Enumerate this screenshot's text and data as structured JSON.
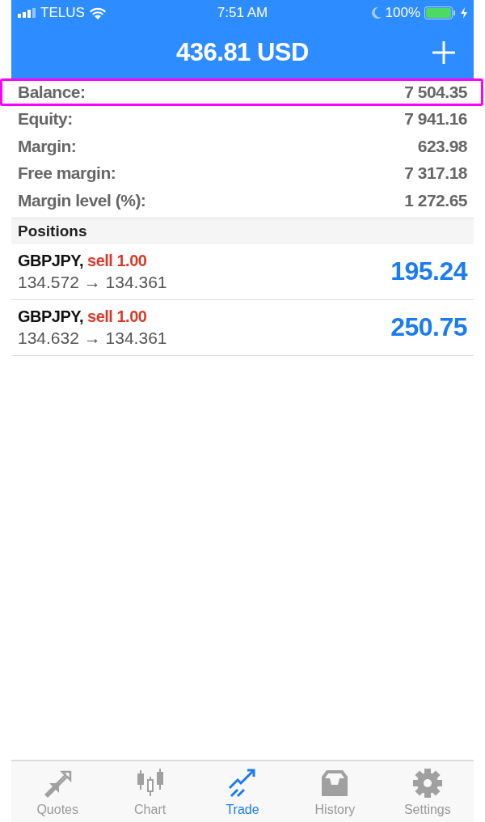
{
  "status_bar": {
    "carrier": "TELUS",
    "time": "7:51 AM",
    "battery": "100%"
  },
  "header": {
    "title": "436.81 USD"
  },
  "account": [
    {
      "label": "Balance:",
      "value": "7 504.35",
      "highlighted": true
    },
    {
      "label": "Equity:",
      "value": "7 941.16",
      "highlighted": false
    },
    {
      "label": "Margin:",
      "value": "623.98",
      "highlighted": false
    },
    {
      "label": "Free margin:",
      "value": "7 317.18",
      "highlighted": false
    },
    {
      "label": "Margin level (%):",
      "value": "1 272.65",
      "highlighted": false
    }
  ],
  "positions": {
    "heading": "Positions",
    "items": [
      {
        "symbol": "GBPJPY,",
        "order": "sell 1.00",
        "prices": "134.572 → 134.361",
        "profit": "195.24"
      },
      {
        "symbol": "GBPJPY,",
        "order": "sell 1.00",
        "prices": "134.632 → 134.361",
        "profit": "250.75"
      }
    ]
  },
  "tabs": [
    {
      "label": "Quotes",
      "kind": "quotes",
      "selected": false
    },
    {
      "label": "Chart",
      "kind": "chart",
      "selected": false
    },
    {
      "label": "Trade",
      "kind": "trade",
      "selected": true
    },
    {
      "label": "History",
      "kind": "history",
      "selected": false
    },
    {
      "label": "Settings",
      "kind": "settings",
      "selected": false
    }
  ]
}
